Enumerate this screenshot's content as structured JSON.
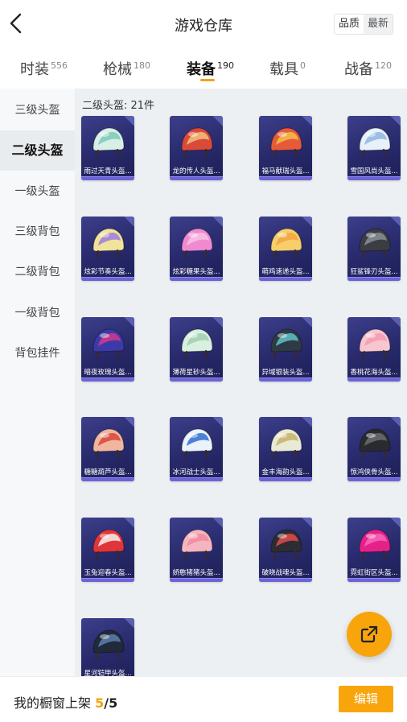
{
  "header": {
    "title": "游戏仓库",
    "sort_options": [
      "品质",
      "最新"
    ],
    "sort_active": "最新"
  },
  "tabs": [
    {
      "label": "时装",
      "count": "556"
    },
    {
      "label": "枪械",
      "count": "180"
    },
    {
      "label": "装备",
      "count": "190",
      "active": true
    },
    {
      "label": "载具",
      "count": "0"
    },
    {
      "label": "战备",
      "count": "120"
    }
  ],
  "sidebar": {
    "items": [
      {
        "label": "三级头盔"
      },
      {
        "label": "二级头盔",
        "active": true
      },
      {
        "label": "一级头盔"
      },
      {
        "label": "三级背包"
      },
      {
        "label": "二级背包"
      },
      {
        "label": "一级背包"
      },
      {
        "label": "背包挂件"
      }
    ]
  },
  "content": {
    "count_label": "二级头盔: 21件",
    "items": [
      {
        "name": "雨过天青头盔...",
        "primary": "#d8efe8",
        "accent": "#7fc8b8"
      },
      {
        "name": "龙的传人头盔...",
        "primary": "#d94a3a",
        "accent": "#f1c27d"
      },
      {
        "name": "福马献瑞头盔...",
        "primary": "#e65a3a",
        "accent": "#f3c04a"
      },
      {
        "name": "雪国风尚头盔...",
        "primary": "#e8f1fa",
        "accent": "#8fb6e0"
      },
      {
        "name": "炫彩节奏头盔...",
        "primary": "#f1e39a",
        "accent": "#9c7de0"
      },
      {
        "name": "炫彩糖果头盔...",
        "primary": "#f08ad0",
        "accent": "#f7c1e6"
      },
      {
        "name": "萌鸡速递头盔...",
        "primary": "#f6cf6a",
        "accent": "#f2a440"
      },
      {
        "name": "狂鲨锋刃头盔...",
        "primary": "#3a3d42",
        "accent": "#8a8f96"
      },
      {
        "name": "暗夜玫瑰头盔...",
        "primary": "#3c3aa8",
        "accent": "#d23a8c"
      },
      {
        "name": "薄荷星砂头盔...",
        "primary": "#d9efe0",
        "accent": "#9fcfb0"
      },
      {
        "name": "异域银装头盔...",
        "primary": "#2e3b45",
        "accent": "#5fc2c9"
      },
      {
        "name": "香桃花海头盔...",
        "primary": "#f7c6cf",
        "accent": "#f29bb0"
      },
      {
        "name": "糖糖葫芦头盔...",
        "primary": "#f0b6a0",
        "accent": "#d9463a"
      },
      {
        "name": "冰河战士头盔...",
        "primary": "#eaf2fa",
        "accent": "#2f6fcf"
      },
      {
        "name": "金丰海韵头盔...",
        "primary": "#e8ead6",
        "accent": "#c9b06a"
      },
      {
        "name": "惊鸿侠骨头盔...",
        "primary": "#2a2b2e",
        "accent": "#6a6d72"
      },
      {
        "name": "玉兔迎春头盔...",
        "primary": "#e0353a",
        "accent": "#f6f0ee"
      },
      {
        "name": "娇憨猪猪头盔...",
        "primary": "#f5b5c0",
        "accent": "#f08aa0"
      },
      {
        "name": "破晓战魂头盔...",
        "primary": "#2c2d33",
        "accent": "#e64a4a"
      },
      {
        "name": "霓虹街区头盔...",
        "primary": "#e6208a",
        "accent": "#f66ab8"
      },
      {
        "name": "星河铠甲头盔...",
        "primary": "#1f2a3a",
        "accent": "#5d7fae"
      }
    ]
  },
  "footer": {
    "label": "我的橱窗上架",
    "current": "5",
    "total": "/5",
    "edit_label": "编辑"
  },
  "colors": {
    "accent": "#f8a50c",
    "card_bg": "#2a2c6e",
    "card_bar": "#6b63d6"
  }
}
